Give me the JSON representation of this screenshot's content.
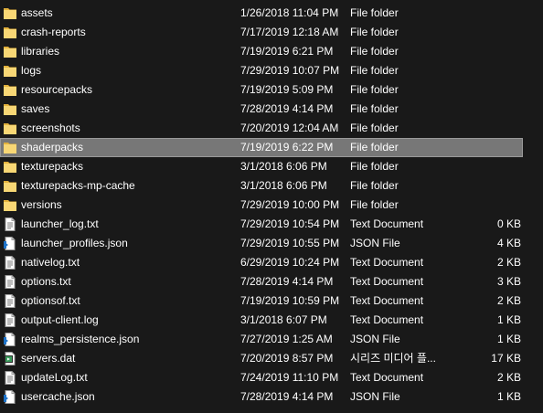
{
  "files": [
    {
      "name": "assets",
      "date": "1/26/2018 11:04 PM",
      "type": "File folder",
      "size": "",
      "icon": "folder-icon"
    },
    {
      "name": "crash-reports",
      "date": "7/17/2019 12:18 AM",
      "type": "File folder",
      "size": "",
      "icon": "folder-icon"
    },
    {
      "name": "libraries",
      "date": "7/19/2019 6:21 PM",
      "type": "File folder",
      "size": "",
      "icon": "folder-icon"
    },
    {
      "name": "logs",
      "date": "7/29/2019 10:07 PM",
      "type": "File folder",
      "size": "",
      "icon": "folder-icon"
    },
    {
      "name": "resourcepacks",
      "date": "7/19/2019 5:09 PM",
      "type": "File folder",
      "size": "",
      "icon": "folder-icon"
    },
    {
      "name": "saves",
      "date": "7/28/2019 4:14 PM",
      "type": "File folder",
      "size": "",
      "icon": "folder-icon"
    },
    {
      "name": "screenshots",
      "date": "7/20/2019 12:04 AM",
      "type": "File folder",
      "size": "",
      "icon": "folder-icon"
    },
    {
      "name": "shaderpacks",
      "date": "7/19/2019 6:22 PM",
      "type": "File folder",
      "size": "",
      "icon": "folder-icon",
      "selected": true
    },
    {
      "name": "texturepacks",
      "date": "3/1/2018 6:06 PM",
      "type": "File folder",
      "size": "",
      "icon": "folder-icon"
    },
    {
      "name": "texturepacks-mp-cache",
      "date": "3/1/2018 6:06 PM",
      "type": "File folder",
      "size": "",
      "icon": "folder-icon"
    },
    {
      "name": "versions",
      "date": "7/29/2019 10:00 PM",
      "type": "File folder",
      "size": "",
      "icon": "folder-icon"
    },
    {
      "name": "launcher_log.txt",
      "date": "7/29/2019 10:54 PM",
      "type": "Text Document",
      "size": "0 KB",
      "icon": "text-document-icon"
    },
    {
      "name": "launcher_profiles.json",
      "date": "7/29/2019 10:55 PM",
      "type": "JSON File",
      "size": "4 KB",
      "icon": "json-file-icon"
    },
    {
      "name": "nativelog.txt",
      "date": "6/29/2019 10:24 PM",
      "type": "Text Document",
      "size": "2 KB",
      "icon": "text-document-icon"
    },
    {
      "name": "options.txt",
      "date": "7/28/2019 4:14 PM",
      "type": "Text Document",
      "size": "3 KB",
      "icon": "text-document-icon"
    },
    {
      "name": "optionsof.txt",
      "date": "7/19/2019 10:59 PM",
      "type": "Text Document",
      "size": "2 KB",
      "icon": "text-document-icon"
    },
    {
      "name": "output-client.log",
      "date": "3/1/2018 6:07 PM",
      "type": "Text Document",
      "size": "1 KB",
      "icon": "text-document-icon"
    },
    {
      "name": "realms_persistence.json",
      "date": "7/27/2019 1:25 AM",
      "type": "JSON File",
      "size": "1 KB",
      "icon": "json-file-icon"
    },
    {
      "name": "servers.dat",
      "date": "7/20/2019 8:57 PM",
      "type": "시리즈 미디어 플...",
      "size": "17 KB",
      "icon": "media-file-icon"
    },
    {
      "name": "updateLog.txt",
      "date": "7/24/2019 11:10 PM",
      "type": "Text Document",
      "size": "2 KB",
      "icon": "text-document-icon"
    },
    {
      "name": "usercache.json",
      "date": "7/28/2019 4:14 PM",
      "type": "JSON File",
      "size": "1 KB",
      "icon": "json-file-icon"
    }
  ],
  "colors": {
    "background": "#191919",
    "selected_row": "#777777",
    "text": "#ffffff",
    "folder_icon": "#f8d775",
    "json_icon_accent": "#1e73c9",
    "media_icon_accent": "#3a9a5b"
  }
}
